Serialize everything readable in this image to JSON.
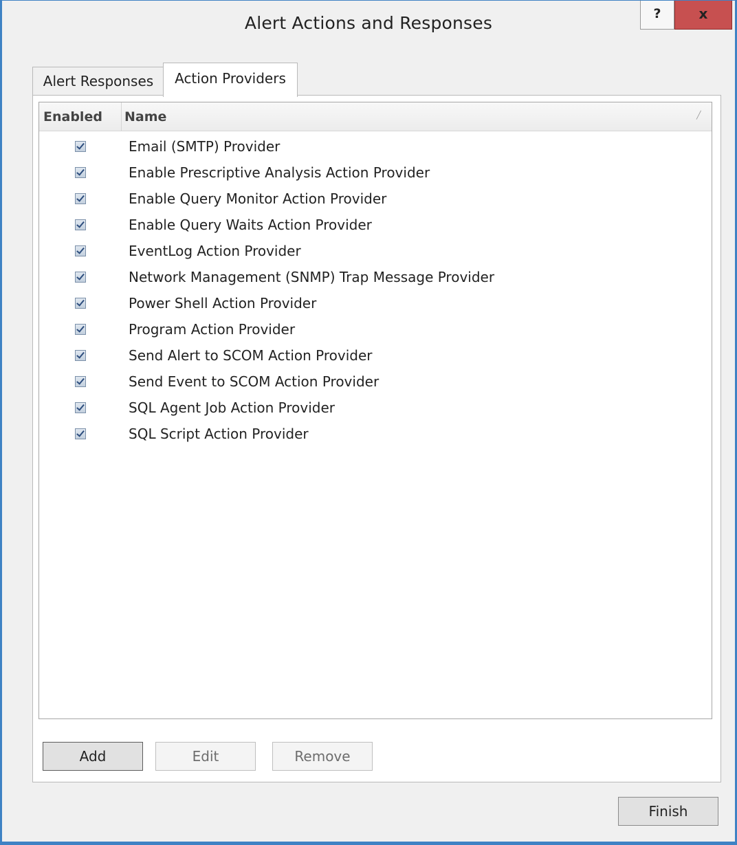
{
  "window": {
    "title": "Alert Actions and Responses",
    "help_label": "?",
    "close_label": "x"
  },
  "tabs": [
    {
      "label": "Alert Responses",
      "selected": false
    },
    {
      "label": "Action Providers",
      "selected": true
    }
  ],
  "grid": {
    "columns": [
      "Enabled",
      "Name"
    ],
    "rows": [
      {
        "enabled": true,
        "name": "Email (SMTP) Provider"
      },
      {
        "enabled": true,
        "name": "Enable Prescriptive Analysis Action Provider"
      },
      {
        "enabled": true,
        "name": "Enable Query Monitor Action Provider"
      },
      {
        "enabled": true,
        "name": "Enable Query Waits Action Provider"
      },
      {
        "enabled": true,
        "name": "EventLog Action Provider"
      },
      {
        "enabled": true,
        "name": "Network Management (SNMP) Trap Message Provider"
      },
      {
        "enabled": true,
        "name": "Power Shell Action Provider"
      },
      {
        "enabled": true,
        "name": "Program Action Provider"
      },
      {
        "enabled": true,
        "name": "Send Alert to SCOM Action Provider"
      },
      {
        "enabled": true,
        "name": "Send Event to SCOM Action Provider"
      },
      {
        "enabled": true,
        "name": "SQL Agent Job Action Provider"
      },
      {
        "enabled": true,
        "name": "SQL Script Action Provider"
      }
    ]
  },
  "buttons": {
    "add": "Add",
    "edit": "Edit",
    "remove": "Remove",
    "finish": "Finish"
  },
  "colors": {
    "window_border": "#3f82c4",
    "close_button": "#c75050"
  },
  "icons": {
    "sort": "sort-indicator-icon",
    "checkbox": "checkbox-checked-icon"
  }
}
